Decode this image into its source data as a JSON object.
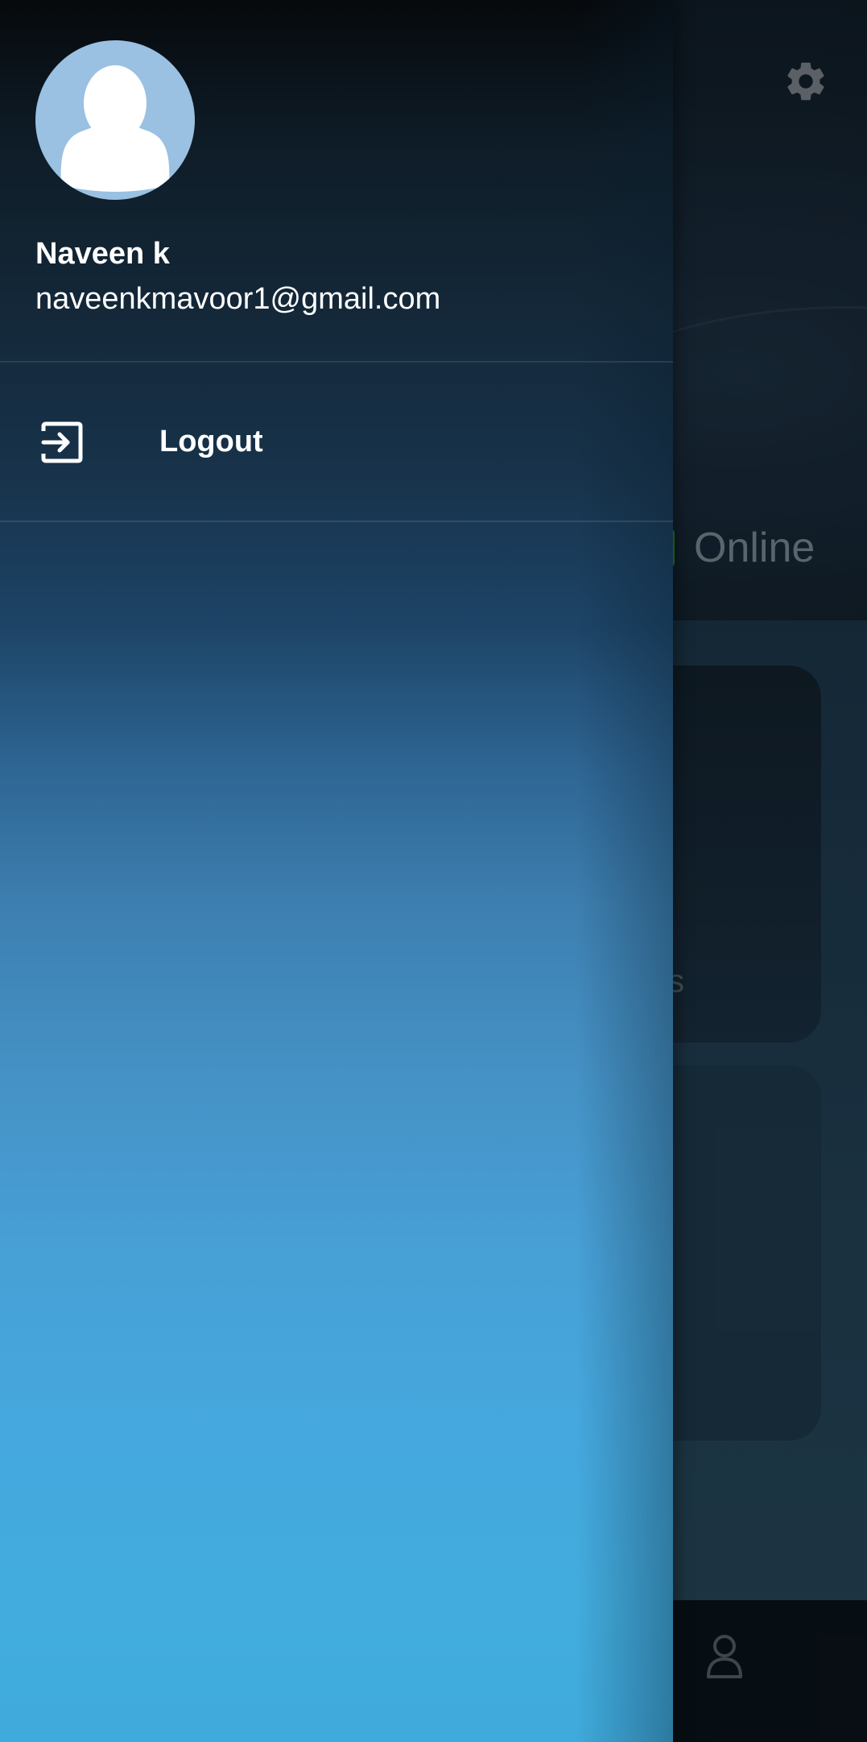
{
  "background_app": {
    "status_text": "Online",
    "status_color": "#3b9c2a",
    "card_fragment_text": "s",
    "settings_icon": "gear-icon",
    "bottom_nav_icon": "person-icon"
  },
  "drawer": {
    "user": {
      "name": "Naveen k",
      "email": "naveenkmavoor1@gmail.com",
      "avatar_icon": "default-avatar"
    },
    "menu": [
      {
        "label": "Logout",
        "icon": "logout-icon"
      }
    ]
  },
  "colors": {
    "avatar_bg": "#9ac0e2",
    "drawer_top": "#06090c",
    "drawer_bottom": "#42acde"
  }
}
